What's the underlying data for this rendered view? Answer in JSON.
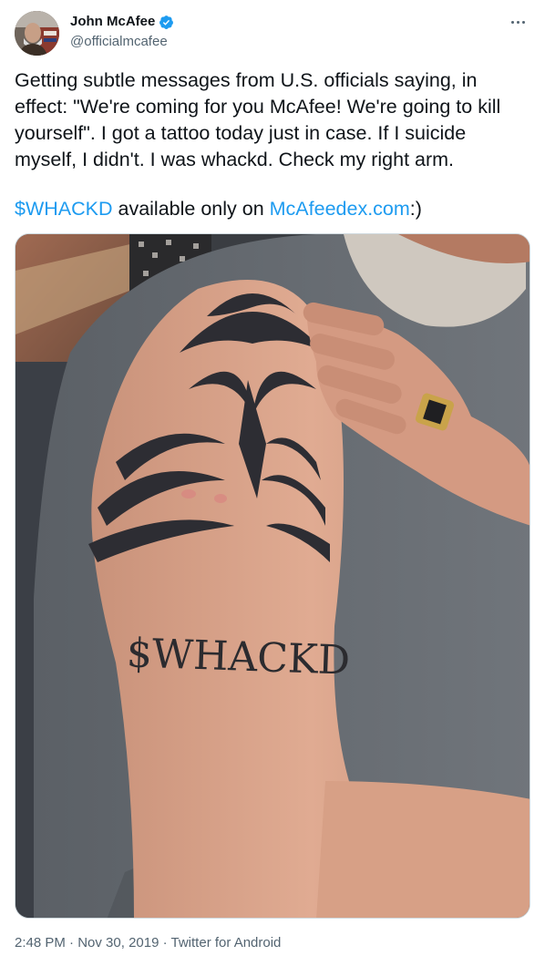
{
  "author": {
    "display_name": "John McAfee",
    "handle": "@officialmcafee",
    "verified": true,
    "avatar_icon": "user-avatar"
  },
  "tweet": {
    "text": "Getting subtle messages from U.S. officials saying, in effect: \"We're coming for you McAfee! We're going to kill yourself\". I got a tattoo today just in case. If I suicide myself, I didn't. I was whackd. Check my right arm.",
    "cashtag": "$WHACKD",
    "middle_text": " available only on ",
    "link": "McAfeedex.com",
    "trailing_text": ":)"
  },
  "media": {
    "tattoo_text": "$WHACKD"
  },
  "meta": {
    "time": "2:48 PM",
    "date": "Nov 30, 2019",
    "source": "Twitter for Android",
    "separator": " · "
  },
  "colors": {
    "link": "#1d9bf0",
    "text": "#0f1419",
    "secondary": "#536471",
    "verified": "#1d9bf0"
  }
}
